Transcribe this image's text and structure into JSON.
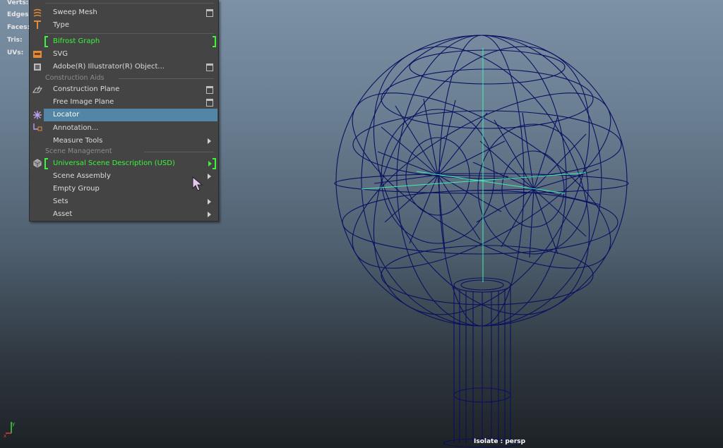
{
  "hud": {
    "stats": [
      "Verts:",
      "Edges:",
      "Faces:",
      "Tris:",
      "UVs:"
    ],
    "camera_label": "Isolate : persp"
  },
  "menu": {
    "items": [
      {
        "label": "Sweep Mesh",
        "icon": "sweep-mesh-icon",
        "option_box": true
      },
      {
        "label": "Type",
        "icon": "type-icon"
      },
      {
        "label": "Bifrost Graph",
        "green": true
      },
      {
        "label": "SVG",
        "icon": "svg-icon"
      },
      {
        "label": "Adobe(R) Illustrator(R) Object...",
        "icon": "illustrator-icon",
        "option_box": true
      },
      {
        "label": "Construction Plane",
        "icon": "construction-plane-icon",
        "option_box": true
      },
      {
        "label": "Free Image Plane",
        "option_box": true
      },
      {
        "label": "Locator",
        "icon": "locator-icon",
        "highlighted": true
      },
      {
        "label": "Annotation...",
        "icon": "annotation-icon"
      },
      {
        "label": "Measure Tools",
        "submenu": true
      },
      {
        "label": "Universal Scene Description (USD)",
        "icon": "usd-icon",
        "green": true,
        "submenu": true
      },
      {
        "label": "Scene Assembly",
        "submenu": true
      },
      {
        "label": "Empty Group"
      },
      {
        "label": "Sets",
        "submenu": true
      },
      {
        "label": "Asset",
        "submenu": true
      }
    ],
    "sections": {
      "construction_aids": "Construction Aids",
      "scene_management": "Scene Management"
    }
  },
  "colors": {
    "wireframe": "#0a1060",
    "highlight": "#5285a6",
    "green_label": "#3cf43c",
    "pivot_lines": "#3cf0b0"
  }
}
